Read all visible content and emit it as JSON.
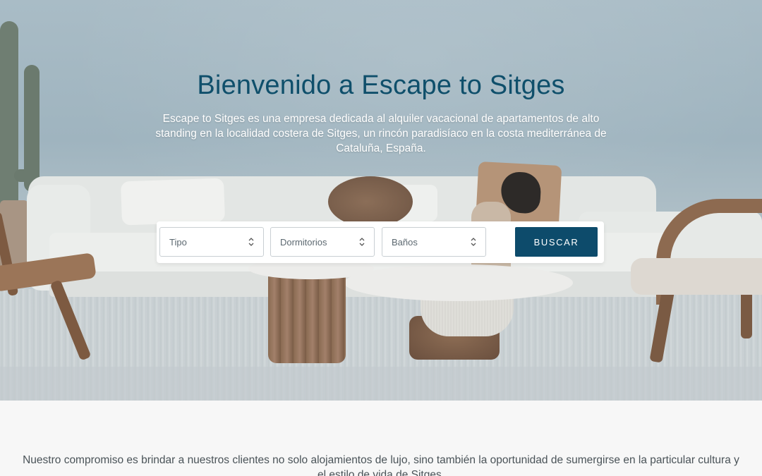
{
  "hero": {
    "title": "Bienvenido a Escape to Sitges",
    "description": "Escape to Sitges es una empresa dedicada al alquiler vacacional de apartamentos de alto standing en la localidad costera de Sitges, un rincón paradisíaco en la costa mediterránea de Cataluña, España."
  },
  "search": {
    "filters": [
      {
        "label": "Tipo",
        "icon": "chevron-up-down-icon"
      },
      {
        "label": "Dormitorios",
        "icon": "chevron-up-down-icon"
      },
      {
        "label": "Baños",
        "icon": "chevron-up-down-icon"
      }
    ],
    "button_label": "BUSCAR"
  },
  "intro": {
    "text": "Nuestro compromiso es brindar a nuestros clientes no solo alojamientos de lujo, sino también la oportunidad de sumergirse en la particular cultura y el estilo de vida de Sitges."
  },
  "colors": {
    "brand": "#0d4b6b",
    "title": "#0f4f6b",
    "page_bg": "#f7f7f7"
  }
}
